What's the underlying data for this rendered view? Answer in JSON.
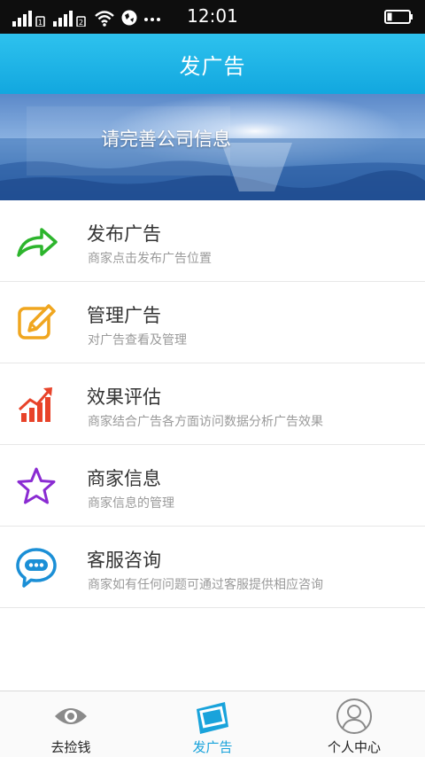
{
  "status_bar": {
    "time": "12:01",
    "icons": [
      "signal-icon",
      "signal-icon",
      "wifi-icon",
      "browser-icon",
      "more-icon",
      "battery-icon"
    ]
  },
  "header": {
    "title": "发广告"
  },
  "banner": {
    "text": "请完善公司信息"
  },
  "menu": {
    "items": [
      {
        "title": "发布广告",
        "desc": "商家点击发布广告位置",
        "icon": "share-arrow-icon",
        "color": "#2db52d"
      },
      {
        "title": "管理广告",
        "desc": "对广告查看及管理",
        "icon": "edit-icon",
        "color": "#f0a61f"
      },
      {
        "title": "效果评估",
        "desc": "商家结合广告各方面访问数据分析广告效果",
        "icon": "chart-growth-icon",
        "color": "#e8432a"
      },
      {
        "title": "商家信息",
        "desc": "商家信息的管理",
        "icon": "star-icon",
        "color": "#8a2bd2"
      },
      {
        "title": "客服咨询",
        "desc": "商家如有任何问题可通过客服提供相应咨询",
        "icon": "chat-bubble-icon",
        "color": "#1b8fd6"
      }
    ]
  },
  "tab_bar": {
    "tabs": [
      {
        "label": "去捡钱",
        "icon": "eye-icon",
        "active": false
      },
      {
        "label": "发广告",
        "icon": "ad-board-icon",
        "active": true
      },
      {
        "label": "个人中心",
        "icon": "user-icon",
        "active": false
      }
    ]
  },
  "colors": {
    "accent": "#19a3db",
    "title_bar": "#12a7df"
  }
}
